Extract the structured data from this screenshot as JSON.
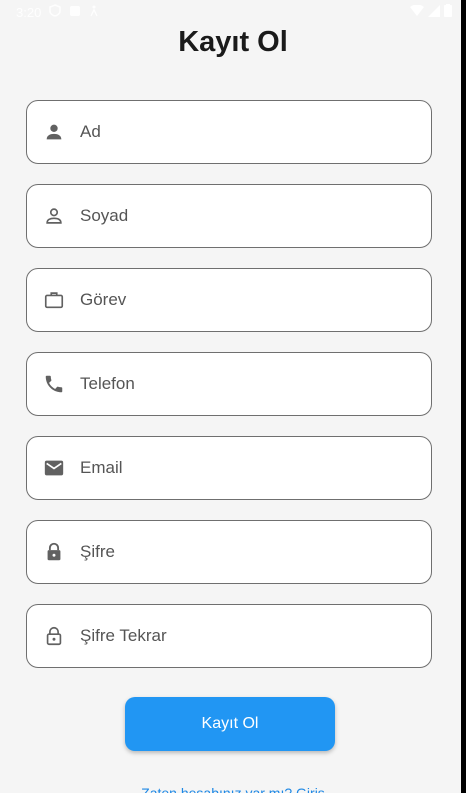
{
  "status_bar": {
    "time": "3:20"
  },
  "page": {
    "title": "Kayıt Ol"
  },
  "form": {
    "fields": [
      {
        "label": "Ad",
        "icon": "person-icon"
      },
      {
        "label": "Soyad",
        "icon": "person-outline-icon"
      },
      {
        "label": "Görev",
        "icon": "briefcase-icon"
      },
      {
        "label": "Telefon",
        "icon": "phone-icon"
      },
      {
        "label": "Email",
        "icon": "mail-icon"
      },
      {
        "label": "Şifre",
        "icon": "lock-icon"
      },
      {
        "label": "Şifre Tekrar",
        "icon": "lock-outline-icon"
      }
    ],
    "submit_label": "Kayıt Ol",
    "footer_link": "Zaten hesabınız var mı? Giriş"
  },
  "colors": {
    "accent": "#2196f3",
    "background": "#f5f5f5",
    "field_border": "#6f6f6f"
  }
}
